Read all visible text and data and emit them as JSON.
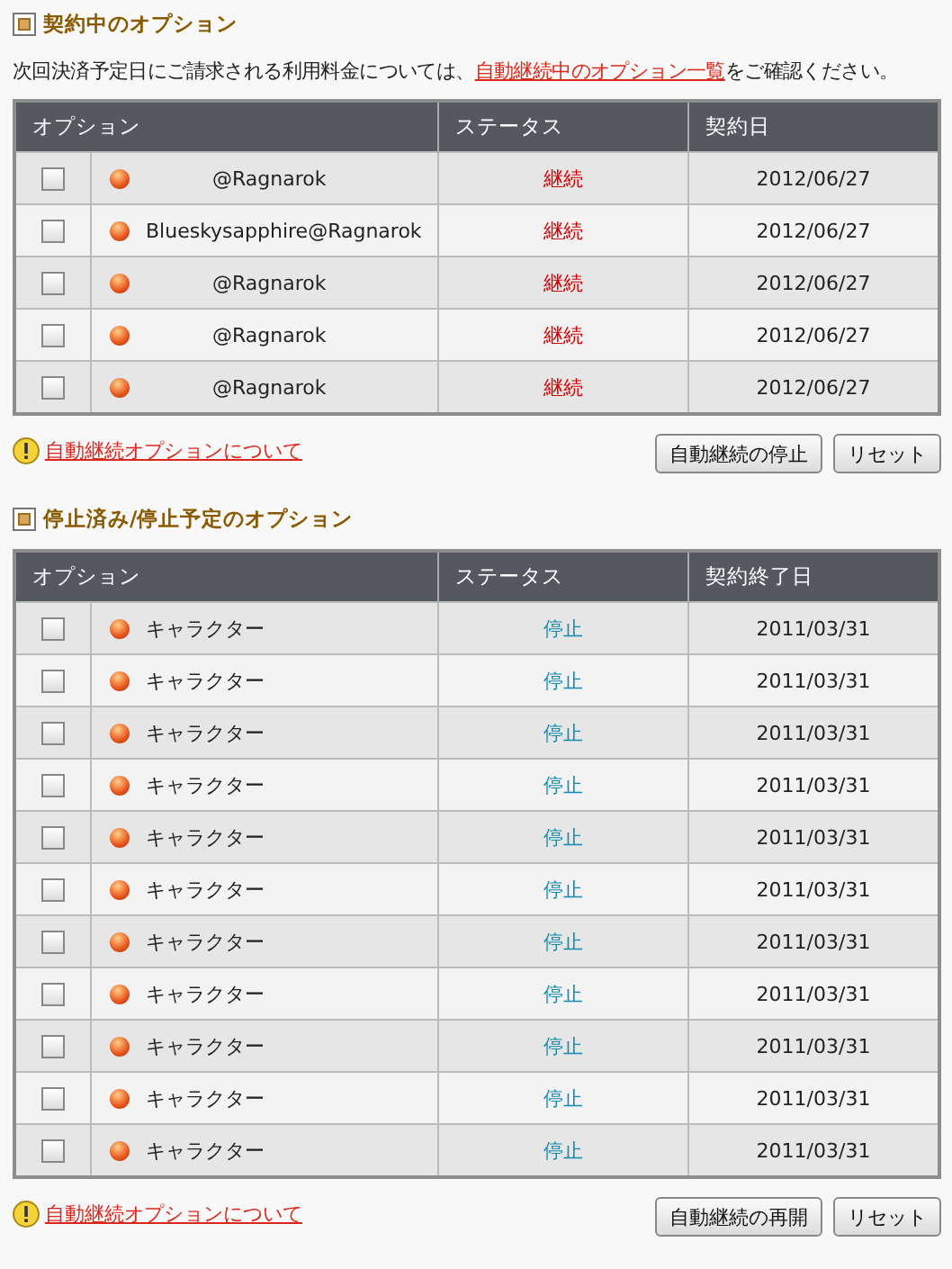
{
  "sections": [
    {
      "title": "契約中のオプション",
      "intro": {
        "before": "次回決済予定日にご請求される利用料金については、",
        "link": "自動継続中のオプション一覧",
        "after": "をご確認ください。"
      },
      "table": {
        "columns": [
          "オプション",
          "ステータス",
          "契約日"
        ],
        "rows": [
          {
            "checked": false,
            "name": "@Ragnarok",
            "redacted": true,
            "status": "継続",
            "kind": "active",
            "date": "2012/06/27"
          },
          {
            "checked": false,
            "name": "Blueskysapphire@Ragnarok",
            "redacted": false,
            "status": "継続",
            "kind": "active",
            "date": "2012/06/27"
          },
          {
            "checked": false,
            "name": "@Ragnarok",
            "redacted": true,
            "status": "継続",
            "kind": "active",
            "date": "2012/06/27"
          },
          {
            "checked": false,
            "name": "@Ragnarok",
            "redacted": true,
            "status": "継続",
            "kind": "active",
            "date": "2012/06/27"
          },
          {
            "checked": false,
            "name": "@Ragnarok",
            "redacted": true,
            "status": "継続",
            "kind": "active",
            "date": "2012/06/27"
          }
        ]
      },
      "notice_link": "自動継続オプションについて",
      "buttons": [
        "自動継続の停止",
        "リセット"
      ]
    },
    {
      "title": "停止済み/停止予定のオプション",
      "table": {
        "columns": [
          "オプション",
          "ステータス",
          "契約終了日"
        ],
        "rows": [
          {
            "checked": false,
            "name": "キャラクター",
            "status": "停止",
            "kind": "stopped",
            "date": "2011/03/31"
          },
          {
            "checked": false,
            "name": "キャラクター",
            "status": "停止",
            "kind": "stopped",
            "date": "2011/03/31"
          },
          {
            "checked": false,
            "name": "キャラクター",
            "status": "停止",
            "kind": "stopped",
            "date": "2011/03/31"
          },
          {
            "checked": false,
            "name": "キャラクター",
            "status": "停止",
            "kind": "stopped",
            "date": "2011/03/31"
          },
          {
            "checked": false,
            "name": "キャラクター",
            "status": "停止",
            "kind": "stopped",
            "date": "2011/03/31"
          },
          {
            "checked": false,
            "name": "キャラクター",
            "status": "停止",
            "kind": "stopped",
            "date": "2011/03/31"
          },
          {
            "checked": false,
            "name": "キャラクター",
            "status": "停止",
            "kind": "stopped",
            "date": "2011/03/31"
          },
          {
            "checked": false,
            "name": "キャラクター",
            "status": "停止",
            "kind": "stopped",
            "date": "2011/03/31"
          },
          {
            "checked": false,
            "name": "キャラクター",
            "status": "停止",
            "kind": "stopped",
            "date": "2011/03/31"
          },
          {
            "checked": false,
            "name": "キャラクター",
            "status": "停止",
            "kind": "stopped",
            "date": "2011/03/31"
          },
          {
            "checked": false,
            "name": "キャラクター",
            "status": "停止",
            "kind": "stopped",
            "date": "2011/03/31"
          }
        ]
      },
      "notice_link": "自動継続オプションについて",
      "buttons": [
        "自動継続の再開",
        "リセット"
      ]
    }
  ]
}
